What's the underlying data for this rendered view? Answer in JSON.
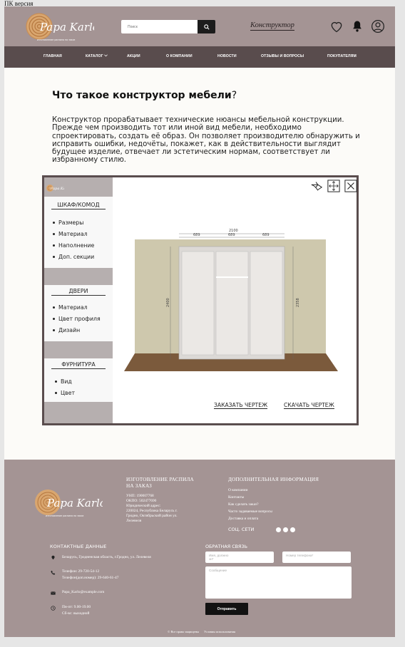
{
  "page_label": "ПК версия",
  "header": {
    "brand": "Papa Karlo",
    "tagline": "изготовление распила на заказ",
    "search_placeholder": "Поиск",
    "constructor_link": "Конструктор"
  },
  "nav": [
    "ГЛАВНАЯ",
    "КАТАЛОГ",
    "АКЦИИ",
    "О КОМПАНИИ",
    "НОВОСТИ",
    "ОТЗЫВЫ И ВОПРОСЫ",
    "ПОКУПАТЕЛЯМ"
  ],
  "main": {
    "title": "Что такое конструктор мебели",
    "title_mark": "?",
    "intro": "Конструктор прорабатывает технические нюансы мебельной конструкции. Прежде чем производить тот или иной вид мебели, необходимо спроектировать, создать её образ. Он позволяет производителю обнаружить и исправить ошибки, недочёты, покажет, как в действительности выглядит будущее изделие, отвечает ли эстетическим нормам, соответствует ли избранному стилю."
  },
  "constructor": {
    "sections": [
      {
        "title": "ШКАФ/КОМОД",
        "items": [
          "Размеры",
          "Материал",
          "Наполнение",
          "Доп. секции"
        ]
      },
      {
        "title": "ДВЕРИ",
        "items": [
          "Материал",
          "Цвет профиля",
          "Дизайн"
        ]
      },
      {
        "title": "ФУРНИТУРА",
        "items": [
          "Вид",
          "Цвет"
        ]
      }
    ],
    "dims": {
      "total": "2100",
      "section": "689",
      "height_left": "2400",
      "height_right": "2358"
    },
    "order_drawing": "ЗАКАЗАТЬ ЧЕРТЕЖ",
    "download_drawing": "СКАЧАТЬ ЧЕРТЕЖ",
    "icons": [
      "share-icon",
      "fullscreen-icon",
      "close-icon"
    ]
  },
  "footer": {
    "brand": "Papa Karlo",
    "tagline": "изготовление распила на заказ",
    "company_heading_1": "ИЗГОТОВЛЕНИЕ РАСПИЛА",
    "company_heading_2": "НА ЗАКАЗ",
    "company_lines": [
      "УНП: 190007768",
      "ОКПО: 502477690",
      "Юридический адрес:",
      "220024, Республика Беларусь г.",
      "Гродно, Октябрьский район ул.",
      "Лелевеля"
    ],
    "info_heading": "ДОПОЛНИТЕЛЬНАЯ ИНФОРМАЦИЯ",
    "info_links": [
      "О компании",
      "Контакты",
      "Как сделать заказ?",
      "Часто задаваемые вопросы",
      "Доставка и оплата"
    ],
    "social_label": "СОЦ. СЕТИ",
    "contacts_heading": "КОНТАКТНЫЕ ДАННЫЕ",
    "address": "Беларусь, Гродненская область, г.Гродно, ул. Лелевеля",
    "phone": "Телефон: 29-720-54-12",
    "phone_alt": "Телефон(доп.номер): 29-640-61-47",
    "email": "Papa_Karlo@example.com",
    "hours": "Пн-пт: 9.00-19.00",
    "weekend": "Сб-вс: выходной",
    "feedback_heading": "ОБРАТНАЯ СВЯЗЬ",
    "name_placeholder": "Имя, должно\nзн*",
    "phone_placeholder": "Номер телефона*",
    "message_placeholder": "Сообщение",
    "send_label": "Отправить",
    "copyright": "Все права защищены",
    "terms": "Условия использования"
  },
  "colors": {
    "header": "#a49494",
    "nav": "#594c4d",
    "footer": "#a49494",
    "frame": "#5a4d4e"
  }
}
